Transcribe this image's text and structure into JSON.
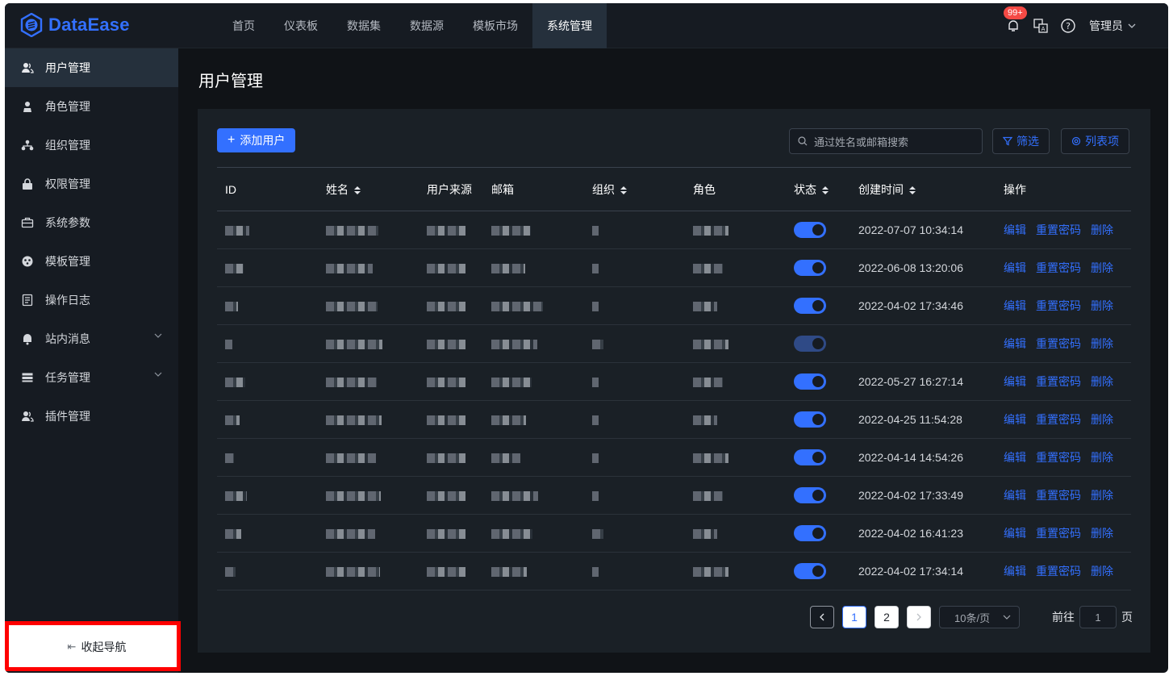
{
  "app": {
    "name": "DataEase"
  },
  "topnav": {
    "items": [
      {
        "label": "首页"
      },
      {
        "label": "仪表板"
      },
      {
        "label": "数据集"
      },
      {
        "label": "数据源"
      },
      {
        "label": "模板市场"
      },
      {
        "label": "系统管理",
        "active": true
      }
    ],
    "notification_badge": "99+",
    "user_label": "管理员"
  },
  "sidebar": {
    "items": [
      {
        "label": "用户管理",
        "icon": "users-icon",
        "active": true
      },
      {
        "label": "角色管理",
        "icon": "role-icon"
      },
      {
        "label": "组织管理",
        "icon": "org-tree-icon"
      },
      {
        "label": "权限管理",
        "icon": "lock-icon"
      },
      {
        "label": "系统参数",
        "icon": "briefcase-icon"
      },
      {
        "label": "模板管理",
        "icon": "template-icon"
      },
      {
        "label": "操作日志",
        "icon": "log-icon"
      },
      {
        "label": "站内消息",
        "icon": "bell-icon",
        "expandable": true
      },
      {
        "label": "任务管理",
        "icon": "task-icon",
        "expandable": true
      },
      {
        "label": "插件管理",
        "icon": "plugin-icon"
      }
    ],
    "collapse_label": "收起导航"
  },
  "main": {
    "title": "用户管理",
    "add_button": "添加用户",
    "search_placeholder": "通过姓名或邮箱搜索",
    "filter_button": "筛选",
    "columns_button": "列表项",
    "table": {
      "headers": [
        "ID",
        "姓名",
        "用户来源",
        "邮箱",
        "组织",
        "角色",
        "状态",
        "创建时间",
        "操作"
      ],
      "rows": [
        {
          "created": "2022-07-07 10:34:14",
          "enabled": true
        },
        {
          "created": "2022-06-08 13:20:06",
          "enabled": true
        },
        {
          "created": "2022-04-02 17:34:46",
          "enabled": true
        },
        {
          "created": "",
          "enabled": true,
          "disabled_switch": true
        },
        {
          "created": "2022-05-27 16:27:14",
          "enabled": true
        },
        {
          "created": "2022-04-25 11:54:28",
          "enabled": true
        },
        {
          "created": "2022-04-14 14:54:26",
          "enabled": true
        },
        {
          "created": "2022-04-02 17:33:49",
          "enabled": true
        },
        {
          "created": "2022-04-02 16:41:23",
          "enabled": true
        },
        {
          "created": "2022-04-02 17:34:14",
          "enabled": true
        }
      ],
      "row_actions": [
        "编辑",
        "重置密码",
        "删除"
      ]
    },
    "pagination": {
      "pages": [
        "1",
        "2"
      ],
      "current": "1",
      "page_size": "10条/页",
      "goto_prefix": "前往",
      "goto_value": "1",
      "goto_suffix": "页"
    }
  },
  "colors": {
    "accent": "#3370ff",
    "background": "#101317",
    "panel": "#1a2026",
    "highlight_box": "#ff0000"
  }
}
